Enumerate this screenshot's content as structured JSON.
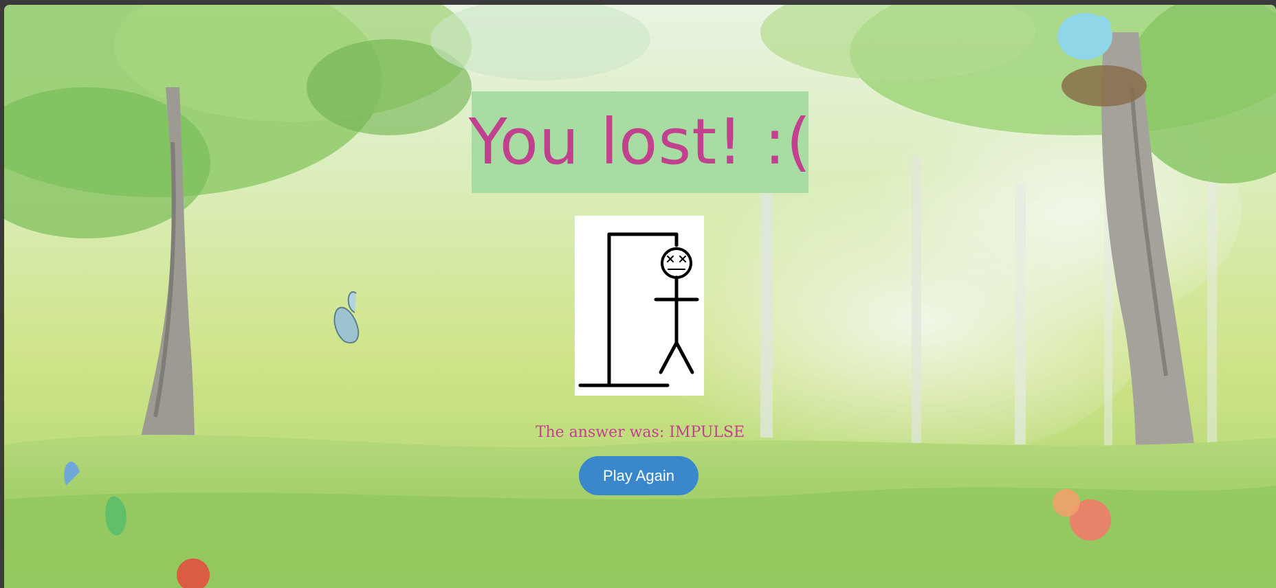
{
  "game": {
    "title": "You lost! :(",
    "answer_label": "The answer was: IMPULSE",
    "play_again_label": "Play Again"
  },
  "hangman": {
    "parts_drawn": [
      "base",
      "pole",
      "beam",
      "rope",
      "head",
      "body",
      "arms",
      "legs"
    ],
    "state": "dead"
  },
  "colors": {
    "title_bg": "#a7dca3",
    "accent_pink": "#c2418f",
    "button_blue": "#3a88cb"
  }
}
